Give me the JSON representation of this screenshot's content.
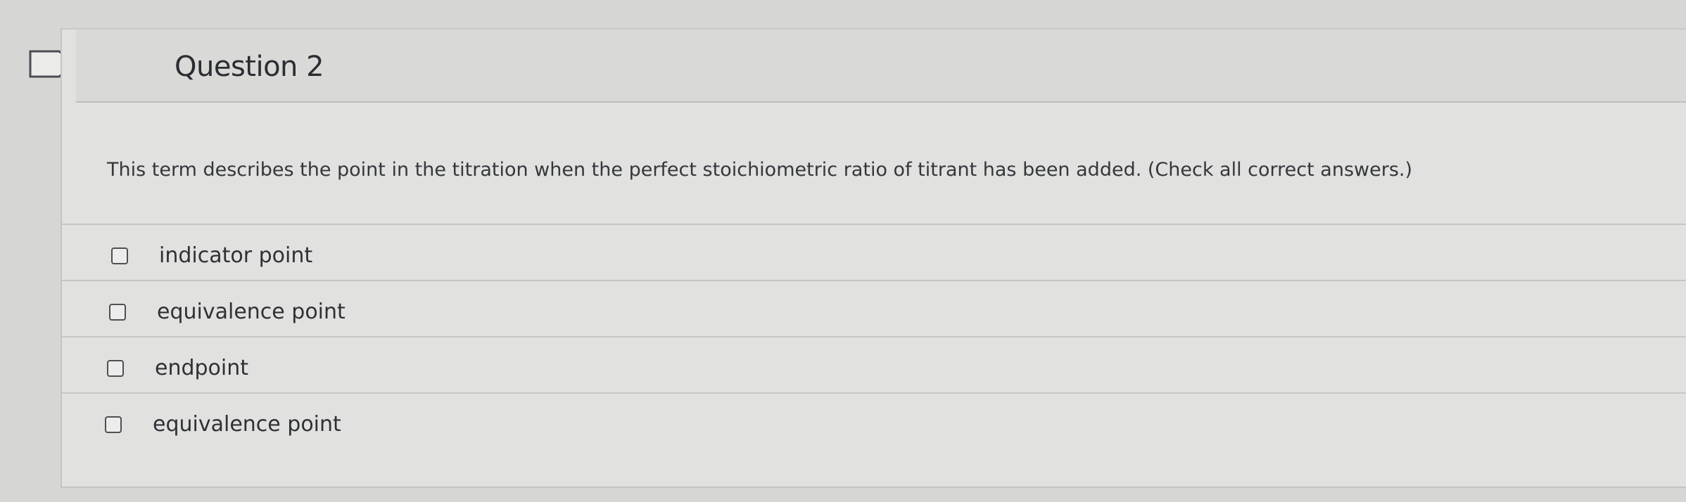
{
  "question": {
    "title": "Question 2",
    "prompt": "This term describes the point in the titration when the perfect stoichiometric ratio of titrant has been added. (Check all correct answers.)"
  },
  "flag": {
    "icon": "flag-icon",
    "stroke_color": "#4a4d52"
  },
  "options": [
    {
      "label": "indicator point",
      "checked": false
    },
    {
      "label": "equivalence point",
      "checked": false
    },
    {
      "label": "endpoint",
      "checked": false
    },
    {
      "label": "equivalence point",
      "checked": false
    }
  ],
  "colors": {
    "page_background": "#d6d6d4",
    "card_background": "#e1e1df",
    "header_background": "#d9d9d7",
    "divider": "#c6c6c4"
  }
}
